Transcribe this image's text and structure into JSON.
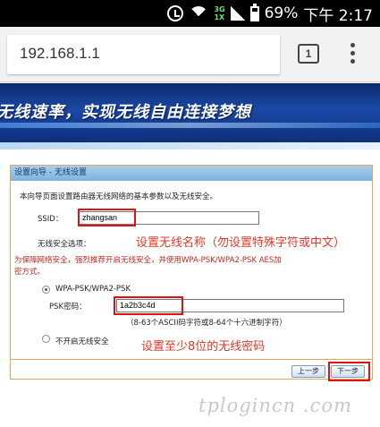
{
  "status_bar": {
    "network_label_top": "3G",
    "network_label_bottom": "1X",
    "battery": "69%",
    "time": "下午 2:17"
  },
  "browser": {
    "url": "192.168.1.1",
    "tab_count": "1"
  },
  "banner": {
    "slogan": "无线速率，实现无线自由连接梦想"
  },
  "wizard": {
    "title": "设置向导 - 无线设置",
    "intro": "本向导页面设置路由器无线网络的基本参数以及无线安全。",
    "ssid_label": "SSID：",
    "ssid_value": "zhangsan",
    "security_label": "无线安全选项：",
    "security_note_line1": "为保障网络安全，强烈推荐开启无线安全，并使用WPA-PSK/WPA2-PSK AES加",
    "security_note_line2": "密方式。",
    "option_wpa": "WPA-PSK/WPA2-PSK",
    "psk_label": "PSK密码：",
    "psk_value": "1a2b3c4d",
    "psk_hint": "（8-63个ASCII码字符或8-64个十六进制字符）",
    "option_none": "不开启无线安全",
    "prev_button": "上一步",
    "next_button": "下一步"
  },
  "annotations": {
    "ssid_tip": "设置无线名称（勿设置特殊字符或中文）",
    "psk_tip": "设置至少8位的无线密码"
  },
  "watermark": "tplogincn .com",
  "colors": {
    "highlight_red": "#e01212",
    "annotation_red": "#e0392a",
    "panel_border": "#e8a35a",
    "banner_blue": "#1b49a6"
  }
}
